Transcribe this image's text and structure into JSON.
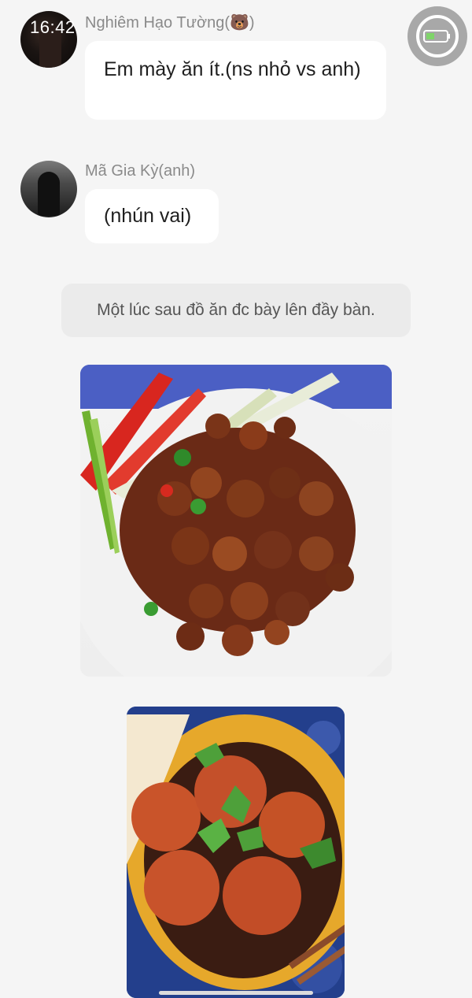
{
  "status_bar": {
    "time": "16:42"
  },
  "messages": [
    {
      "sender": "Nghiêm Hạo Tường(🐻)",
      "text": "Em mày ăn ít.(ns nhỏ vs anh)"
    },
    {
      "sender": "Mã Gia Kỳ(anh)",
      "text": "(nhún vai)"
    }
  ],
  "narration": "Một lúc sau đồ ăn đc bày lên đầy bàn.",
  "images": [
    {
      "icon": "caramelized-pork-dish-photo"
    },
    {
      "icon": "meatballs-bowl-photo"
    }
  ],
  "floating_button": {
    "icon": "assistive-touch-icon"
  },
  "colors": {
    "background": "#f5f5f5",
    "bubble": "#ffffff",
    "narration_bg": "#ebebeb",
    "sender_text": "#8a8a8a"
  }
}
